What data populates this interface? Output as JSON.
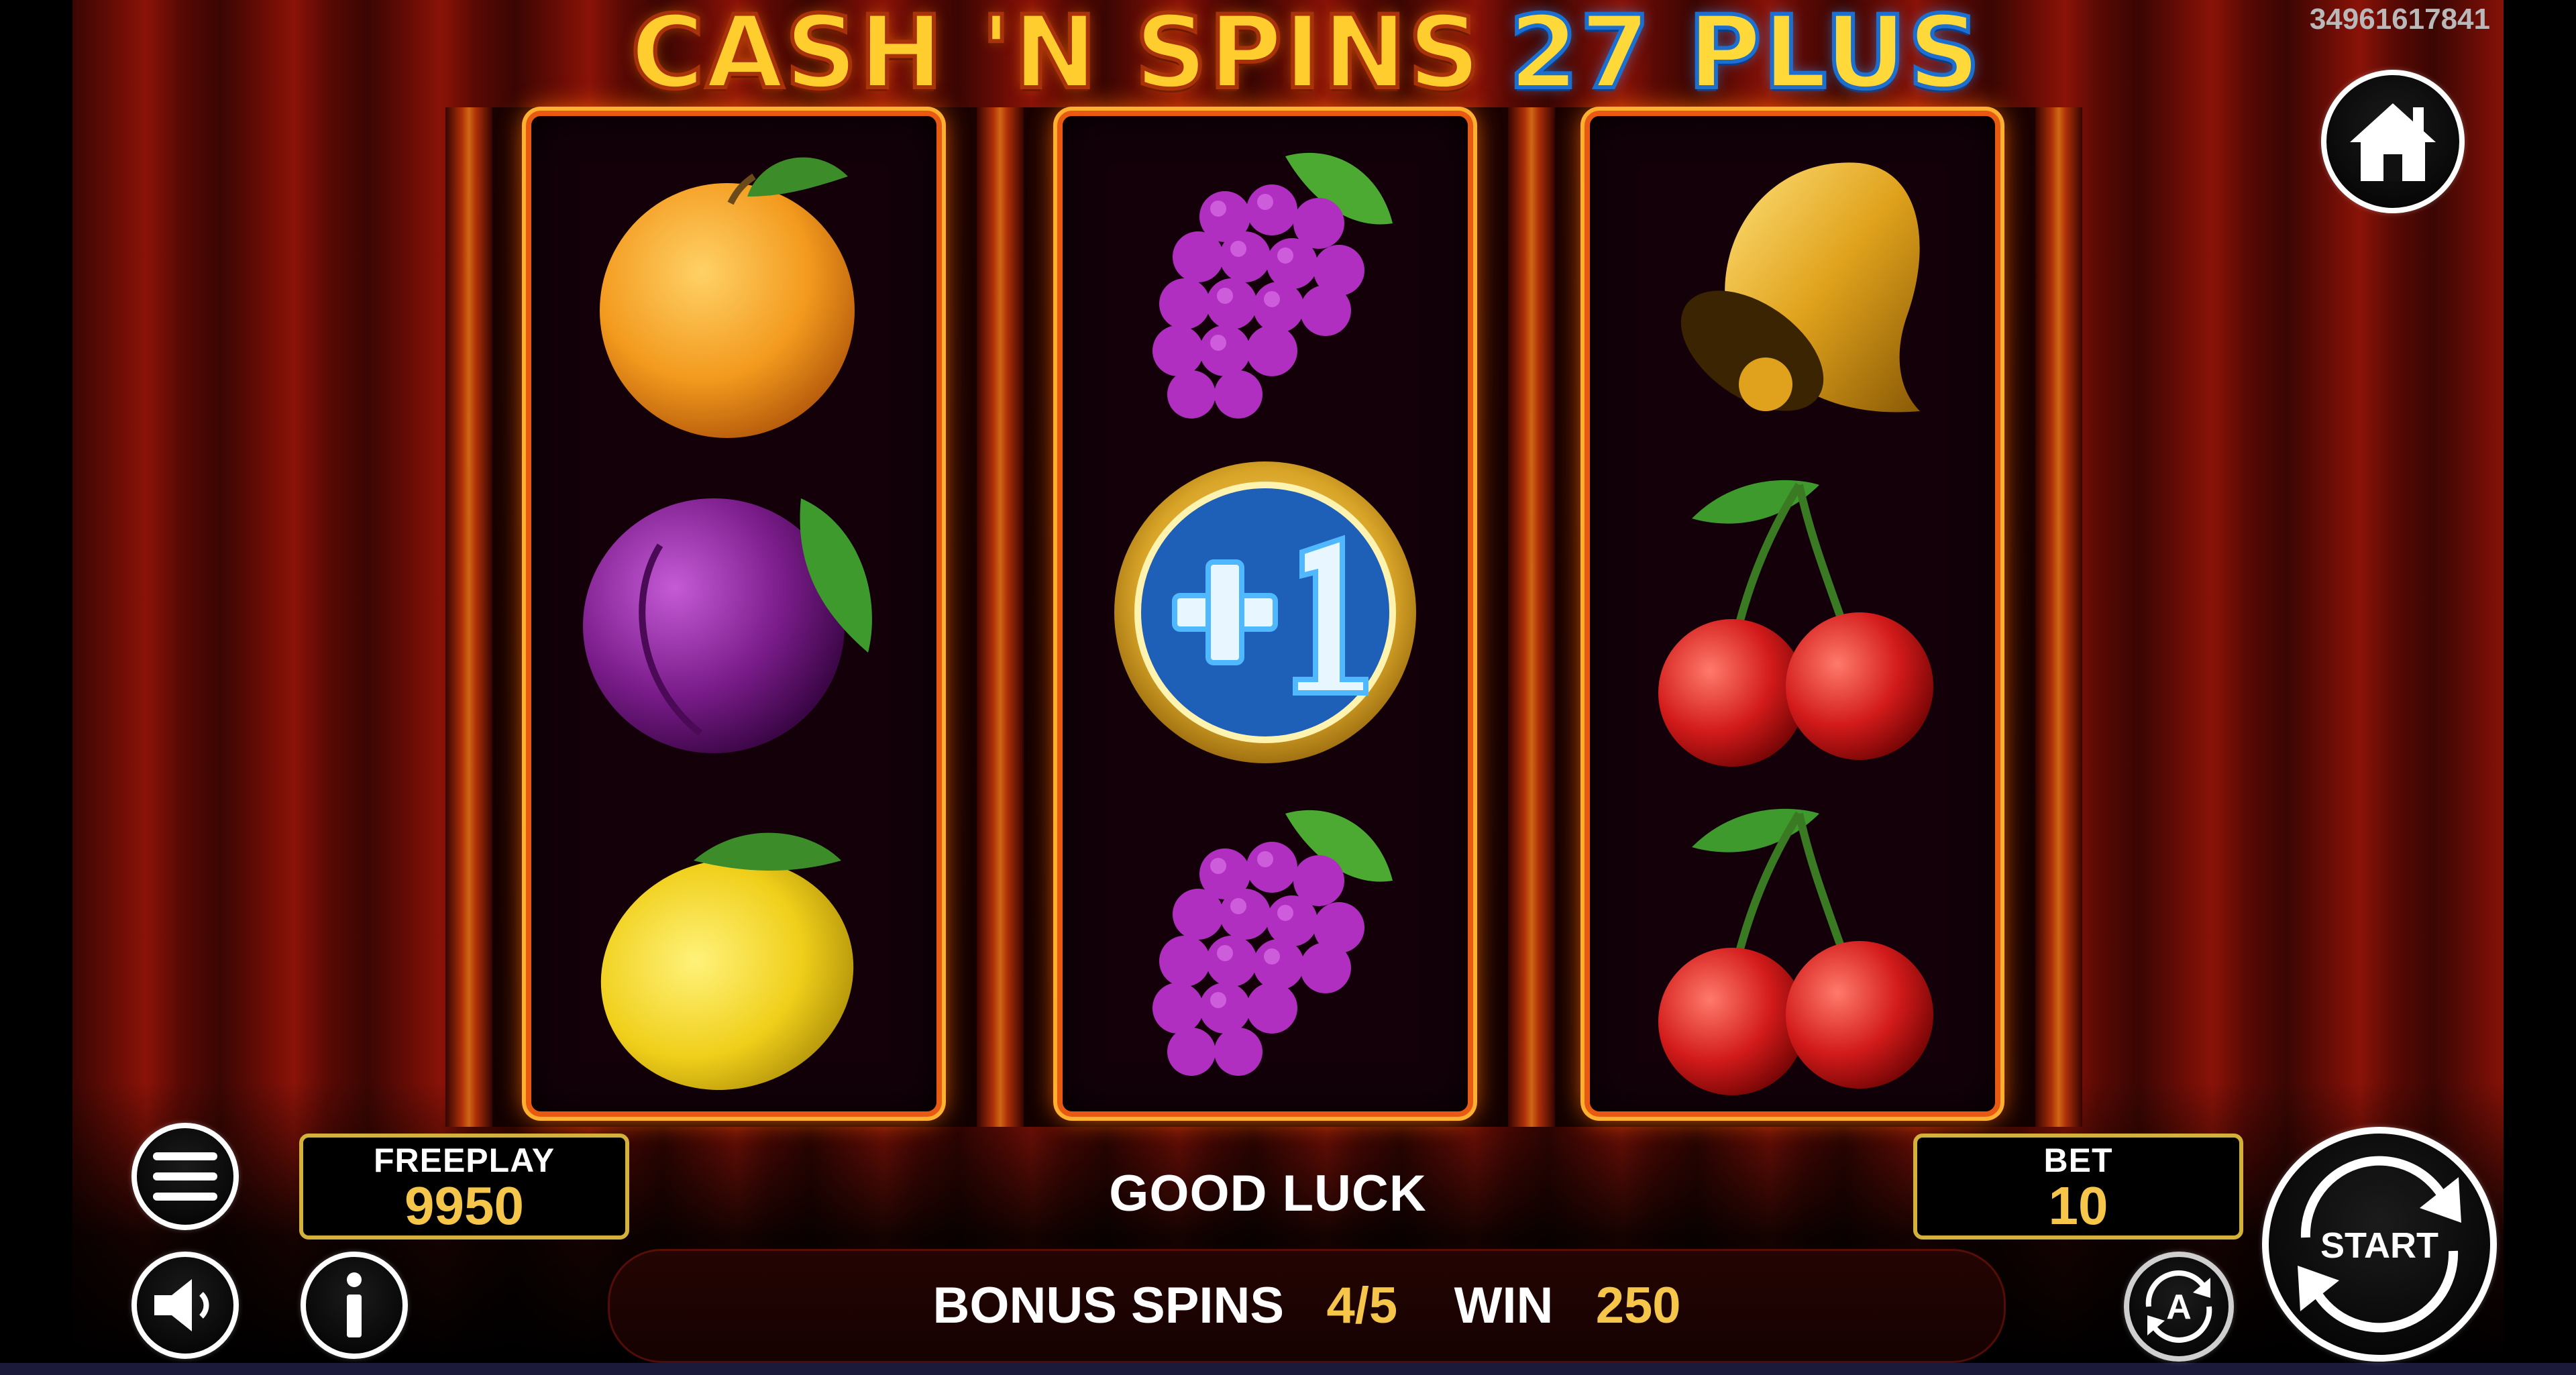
{
  "title": {
    "main": "CASH 'N SPINS",
    "accent": "27 PLUS"
  },
  "session_id": "34961617841",
  "reels": [
    {
      "symbols": [
        "orange",
        "plum",
        "lemon"
      ]
    },
    {
      "symbols": [
        "grapes",
        "plus-one-coin",
        "grapes"
      ]
    },
    {
      "symbols": [
        "bell",
        "cherries",
        "cherries"
      ]
    }
  ],
  "balance": {
    "label": "FREEPLAY",
    "value": "9950"
  },
  "bet": {
    "label": "BET",
    "value": "10"
  },
  "message": "GOOD LUCK",
  "status": {
    "bonus_label": "BONUS SPINS",
    "bonus_value": "4/5",
    "win_label": "WIN",
    "win_value": "250"
  },
  "buttons": {
    "start_label": "START",
    "autoplay_label": "A"
  },
  "icons": {
    "home": "home-icon",
    "menu": "menu-icon",
    "sound": "speaker-icon",
    "info": "info-icon",
    "autoplay": "autoplay-icon",
    "start": "start-spin-icon"
  },
  "colors": {
    "accent_gold": "#f6c64a",
    "frame_orange": "#e85a12",
    "box_border": "#d4b13a"
  }
}
